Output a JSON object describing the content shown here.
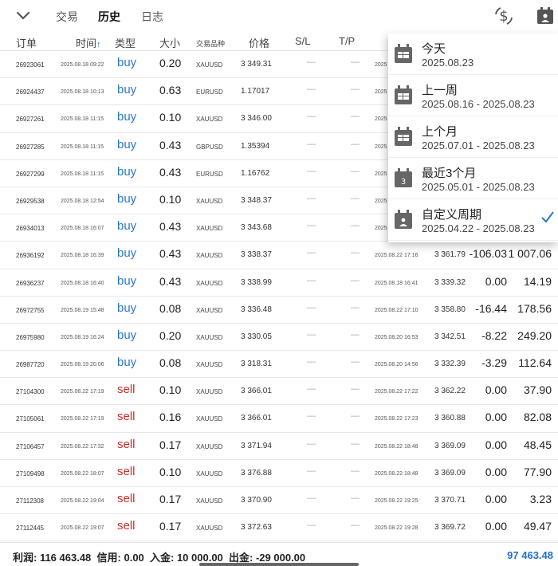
{
  "tabs": {
    "trade": "交易",
    "history": "历史",
    "journal": "日志"
  },
  "columns": {
    "order": "订单",
    "time": "时间",
    "sort_arrow": "↑",
    "type": "类型",
    "size": "大小",
    "symbol": "交易品种",
    "price": "价格",
    "sl": "S/L",
    "tp": "T/P"
  },
  "rows": [
    {
      "order": "26923061",
      "time": "2025.08.18 09:22",
      "type": "buy",
      "size": "0.20",
      "symbol": "XAUUSD",
      "price": "3 349.31",
      "sl": "—",
      "tp": "—",
      "close_time": "2025",
      "close_price": "",
      "swap": "",
      "profit": ""
    },
    {
      "order": "26924437",
      "time": "2025.08.18 10:13",
      "type": "buy",
      "size": "0.63",
      "symbol": "EURUSD",
      "price": "1.17017",
      "sl": "—",
      "tp": "—",
      "close_time": "2025",
      "close_price": "",
      "swap": "",
      "profit": ""
    },
    {
      "order": "26927261",
      "time": "2025.08.18 11:15",
      "type": "buy",
      "size": "0.10",
      "symbol": "XAUUSD",
      "price": "3 346.00",
      "sl": "—",
      "tp": "—",
      "close_time": "2025",
      "close_price": "",
      "swap": "",
      "profit": ""
    },
    {
      "order": "26927285",
      "time": "2025.08.18 11:15",
      "type": "buy",
      "size": "0.43",
      "symbol": "GBPUSD",
      "price": "1.35394",
      "sl": "—",
      "tp": "—",
      "close_time": "2025",
      "close_price": "",
      "swap": "",
      "profit": ""
    },
    {
      "order": "26927299",
      "time": "2025.08.18 11:15",
      "type": "buy",
      "size": "0.43",
      "symbol": "EURUSD",
      "price": "1.16762",
      "sl": "—",
      "tp": "—",
      "close_time": "2025",
      "close_price": "",
      "swap": "",
      "profit": ""
    },
    {
      "order": "26929538",
      "time": "2025.08.18 12:54",
      "type": "buy",
      "size": "0.10",
      "symbol": "XAUUSD",
      "price": "3 348.37",
      "sl": "—",
      "tp": "—",
      "close_time": "2025",
      "close_price": "",
      "swap": "",
      "profit": ""
    },
    {
      "order": "26934013",
      "time": "2025.08.18 16:07",
      "type": "buy",
      "size": "0.43",
      "symbol": "XAUUSD",
      "price": "3 343.68",
      "sl": "—",
      "tp": "—",
      "close_time": "2025",
      "close_price": "",
      "swap": "",
      "profit": ""
    },
    {
      "order": "26936192",
      "time": "2025.08.18 16:39",
      "type": "buy",
      "size": "0.43",
      "symbol": "XAUUSD",
      "price": "3 338.37",
      "sl": "—",
      "tp": "—",
      "close_time": "2025.08.22 17:16",
      "close_price": "3 361.79",
      "swap": "-106.03",
      "profit": "1 007.06"
    },
    {
      "order": "26936237",
      "time": "2025.08.18 16:40",
      "type": "buy",
      "size": "0.43",
      "symbol": "XAUUSD",
      "price": "3 338.99",
      "sl": "—",
      "tp": "—",
      "close_time": "2025.08.18 16:41",
      "close_price": "3 339.32",
      "swap": "0.00",
      "profit": "14.19"
    },
    {
      "order": "26972755",
      "time": "2025.08.19 15:48",
      "type": "buy",
      "size": "0.08",
      "symbol": "XAUUSD",
      "price": "3 336.48",
      "sl": "—",
      "tp": "—",
      "close_time": "2025.08.22 17:10",
      "close_price": "3 358.80",
      "swap": "-16.44",
      "profit": "178.56"
    },
    {
      "order": "26975980",
      "time": "2025.08.19 16:24",
      "type": "buy",
      "size": "0.20",
      "symbol": "XAUUSD",
      "price": "3 330.05",
      "sl": "—",
      "tp": "—",
      "close_time": "2025.08.20 16:53",
      "close_price": "3 342.51",
      "swap": "-8.22",
      "profit": "249.20"
    },
    {
      "order": "26987720",
      "time": "2025.08.19 20:06",
      "type": "buy",
      "size": "0.08",
      "symbol": "XAUUSD",
      "price": "3 318.31",
      "sl": "—",
      "tp": "—",
      "close_time": "2025.08.20 14:56",
      "close_price": "3 332.39",
      "swap": "-3.29",
      "profit": "112.64"
    },
    {
      "order": "27104300",
      "time": "2025.08.22 17:19",
      "type": "sell",
      "size": "0.10",
      "symbol": "XAUUSD",
      "price": "3 366.01",
      "sl": "—",
      "tp": "—",
      "close_time": "2025.08.22 17:22",
      "close_price": "3 362.22",
      "swap": "0.00",
      "profit": "37.90"
    },
    {
      "order": "27105061",
      "time": "2025.08.22 17:19",
      "type": "sell",
      "size": "0.16",
      "symbol": "XAUUSD",
      "price": "3 366.01",
      "sl": "—",
      "tp": "—",
      "close_time": "2025.08.22 17:23",
      "close_price": "3 360.88",
      "swap": "0.00",
      "profit": "82.08"
    },
    {
      "order": "27106457",
      "time": "2025.08.22 17:32",
      "type": "sell",
      "size": "0.17",
      "symbol": "XAUUSD",
      "price": "3 371.94",
      "sl": "—",
      "tp": "—",
      "close_time": "2025.08.22 18:48",
      "close_price": "3 369.09",
      "swap": "0.00",
      "profit": "48.45"
    },
    {
      "order": "27109498",
      "time": "2025.08.22 18:07",
      "type": "sell",
      "size": "0.10",
      "symbol": "XAUUSD",
      "price": "3 376.88",
      "sl": "—",
      "tp": "—",
      "close_time": "2025.08.22 18:48",
      "close_price": "3 369.09",
      "swap": "0.00",
      "profit": "77.90"
    },
    {
      "order": "27112308",
      "time": "2025.08.22 19:04",
      "type": "sell",
      "size": "0.17",
      "symbol": "XAUUSD",
      "price": "3 370.90",
      "sl": "—",
      "tp": "—",
      "close_time": "2025.08.22 19:25",
      "close_price": "3 370.71",
      "swap": "0.00",
      "profit": "3.23"
    },
    {
      "order": "27112445",
      "time": "2025.08.22 19:07",
      "type": "sell",
      "size": "0.17",
      "symbol": "XAUUSD",
      "price": "3 372.63",
      "sl": "—",
      "tp": "—",
      "close_time": "2025.08.22 19:28",
      "close_price": "3 369.72",
      "swap": "0.00",
      "profit": "49.47"
    }
  ],
  "footer": {
    "profit": "利润: 116 463.48",
    "credit": "信用: 0.00",
    "deposit": "入金: 10 000.00",
    "withdrawal": "出金: -29 000.00",
    "balance": "97 463.48"
  },
  "dropdown": {
    "items": [
      {
        "label": "今天",
        "range": "2025.08.23",
        "icon": "calendar-icon",
        "badge": "",
        "selected": false
      },
      {
        "label": "上一周",
        "range": "2025.08.16 - 2025.08.23",
        "icon": "calendar-week-icon",
        "badge": "",
        "selected": false
      },
      {
        "label": "上个月",
        "range": "2025.07.01 - 2025.08.23",
        "icon": "calendar-month-icon",
        "badge": "",
        "selected": false
      },
      {
        "label": "最近3个月",
        "range": "2025.05.01 - 2025.08.23",
        "icon": "calendar-3months-icon",
        "badge": "3",
        "selected": false
      },
      {
        "label": "自定义周期",
        "range": "2025.04.22 - 2025.08.23",
        "icon": "calendar-custom-icon",
        "badge": "",
        "selected": true
      }
    ]
  },
  "colors": {
    "buy": "#2a78c7",
    "sell": "#c9302c",
    "balance": "#1f6fd1",
    "check": "#2a78c7"
  }
}
